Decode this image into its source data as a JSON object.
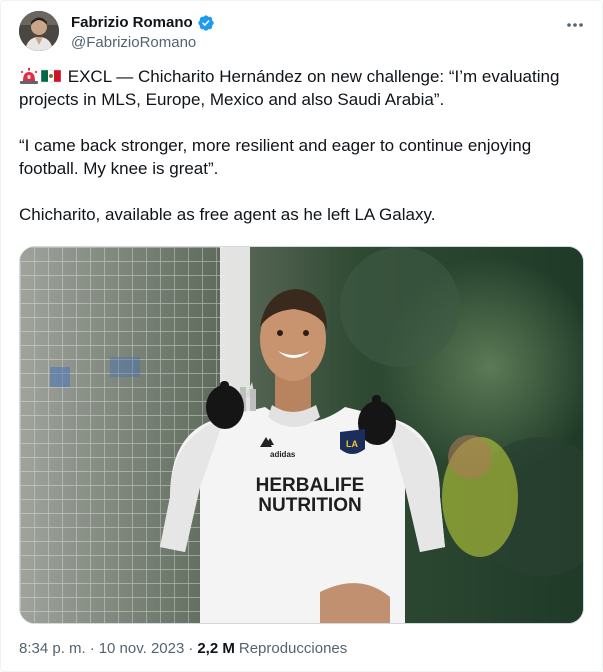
{
  "author": {
    "name": "Fabrizio Romano",
    "handle": "@FabrizioRomano",
    "verified": true,
    "avatar_icon": "avatar-photo",
    "verified_color": "#1d9bf0"
  },
  "tweet": {
    "emojis": [
      "rotating-light-emoji",
      "mexico-flag-emoji"
    ],
    "line1": "EXCL — Chicharito Hernández on new challenge: “I’m evaluating projects in MLS, Europe, Mexico and also Saudi Arabia”.",
    "line2": "“I came back stronger, more resilient and eager to continue enjoying football. My knee is great”.",
    "line3": "Chicharito, available as free agent as he left LA Galaxy."
  },
  "media": {
    "jersey_line1": "HERBALIFE",
    "jersey_line2": "NUTRITION",
    "badge_text": "LA",
    "brand": "adidas"
  },
  "footer": {
    "time": "8:34 p. m.",
    "separator": "·",
    "date": "10 nov. 2023",
    "views_count": "2,2 M",
    "views_label": "Reproducciones"
  }
}
